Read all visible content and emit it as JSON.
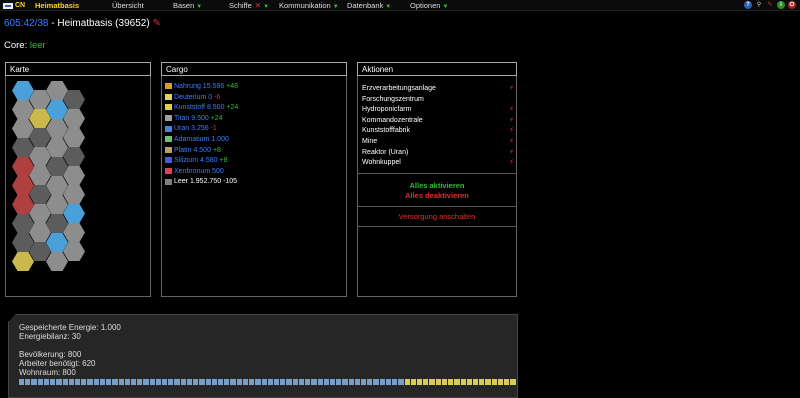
{
  "nav": {
    "logo_text": "CN",
    "items": [
      {
        "label": "Heimatbasis",
        "active": true
      },
      {
        "label": "Übersicht"
      },
      {
        "label": "Basen"
      },
      {
        "label": "Schiffe"
      },
      {
        "label": "Kommunikation"
      },
      {
        "label": "Datenbank"
      },
      {
        "label": "Optionen"
      }
    ],
    "icons": [
      "help-icon",
      "search-icon",
      "edit-icon",
      "info-icon",
      "power-icon"
    ]
  },
  "header": {
    "coords": "605:42/38",
    "title": " - Heimatbasis (39652)",
    "core_label": "Core:",
    "core_value": "leer"
  },
  "karte": {
    "title": "Karte"
  },
  "cargo": {
    "title": "Cargo",
    "items": [
      {
        "name": "Nahrung 15.586",
        "delta": "+48",
        "delta_type": "pos",
        "icon_color": "#d8a020"
      },
      {
        "name": "Deuterium 0",
        "delta": "-6",
        "delta_type": "neg",
        "icon_color": "#e0d060"
      },
      {
        "name": "Kunststoff 8.500",
        "delta": "+24",
        "delta_type": "pos",
        "icon_color": "#e0d040"
      },
      {
        "name": "Titan 9.500",
        "delta": "+24",
        "delta_type": "pos",
        "icon_color": "#a0a0a0"
      },
      {
        "name": "Uran 3.256",
        "delta": "-1",
        "delta_type": "neg",
        "icon_color": "#4a80e0"
      },
      {
        "name": "Adamatium 1.000",
        "delta": "",
        "delta_type": "pos",
        "icon_color": "#70c070"
      },
      {
        "name": "Platin 4.500",
        "delta": "+8",
        "delta_type": "pos",
        "icon_color": "#c0a060"
      },
      {
        "name": "Silizium 4.580",
        "delta": "+8",
        "delta_type": "pos",
        "icon_color": "#4060d0"
      },
      {
        "name": "Xenbronum 500",
        "delta": "",
        "delta_type": "pos",
        "icon_color": "#e04060"
      },
      {
        "name": "Leer 1.952.750",
        "delta": "-105",
        "delta_type": "neg_white",
        "icon_color": "#808080"
      }
    ]
  },
  "aktionen": {
    "title": "Aktionen",
    "buildings": [
      {
        "name": "Erzverarbeitungsanlage",
        "power": true
      },
      {
        "name": "Forschungszentrum",
        "power": false
      },
      {
        "name": "Hydroponicfarm",
        "power": true
      },
      {
        "name": "Kommandozentrale",
        "power": true
      },
      {
        "name": "Kunststofffabrik",
        "power": true
      },
      {
        "name": "Mine",
        "power": true
      },
      {
        "name": "Reaktor (Uran)",
        "power": true
      },
      {
        "name": "Wohnkuppel",
        "power": true
      }
    ],
    "activate_all": "Alles aktivieren",
    "deactivate_all": "Alles deaktivieren",
    "supply_off": "Versorgung anschalten"
  },
  "energy": {
    "stored": "Gespeicherte Energie: 1.000",
    "balance": "Energiebilanz: 30",
    "population": "Bevölkerung: 800",
    "workers_needed": "Arbeiter benötigt: 620",
    "living_space": "Wohnraum: 800"
  }
}
